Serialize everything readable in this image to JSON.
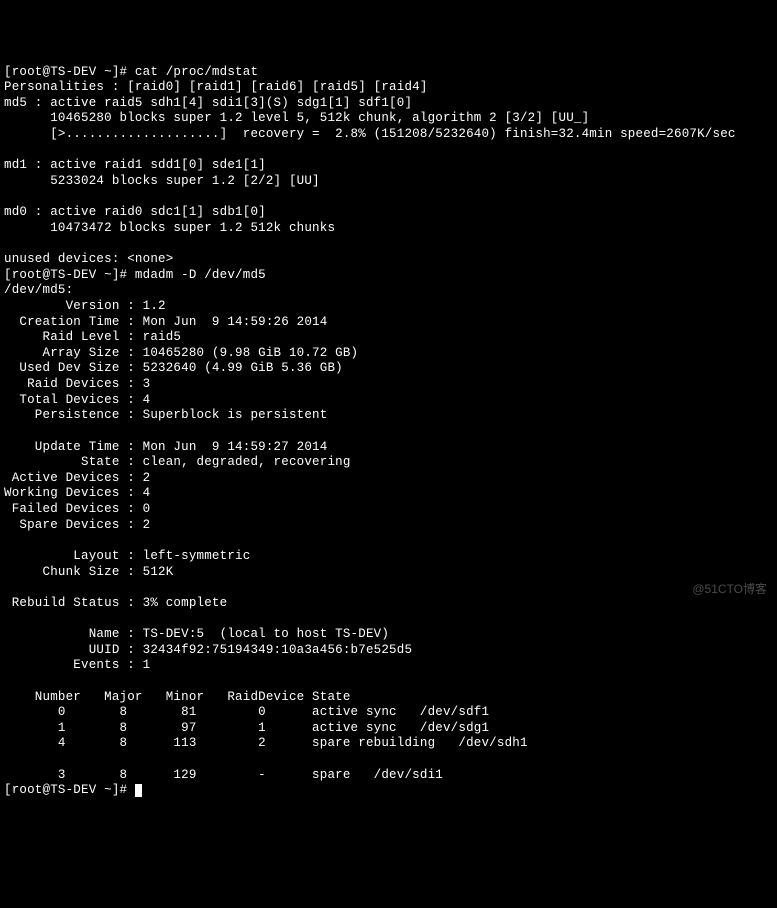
{
  "prompt1": "[root@TS-DEV ~]# ",
  "cmd1": "cat /proc/mdstat",
  "mdstat": {
    "personalities": "Personalities : [raid0] [raid1] [raid6] [raid5] [raid4]",
    "md5_l1": "md5 : active raid5 sdh1[4] sdi1[3](S) sdg1[1] sdf1[0]",
    "md5_l2": "      10465280 blocks super 1.2 level 5, 512k chunk, algorithm 2 [3/2] [UU_]",
    "md5_l3": "      [>....................]  recovery =  2.8% (151208/5232640) finish=32.4min speed=2607K/sec",
    "blank1": "",
    "md1_l1": "md1 : active raid1 sdd1[0] sde1[1]",
    "md1_l2": "      5233024 blocks super 1.2 [2/2] [UU]",
    "blank2": "",
    "md0_l1": "md0 : active raid0 sdc1[1] sdb1[0]",
    "md0_l2": "      10473472 blocks super 1.2 512k chunks",
    "blank3": "",
    "unused": "unused devices: <none>"
  },
  "prompt2": "[root@TS-DEV ~]# ",
  "cmd2": "mdadm -D /dev/md5",
  "mdadm": {
    "header": "/dev/md5:",
    "version": "        Version : 1.2",
    "creation_time": "  Creation Time : Mon Jun  9 14:59:26 2014",
    "raid_level": "     Raid Level : raid5",
    "array_size": "     Array Size : 10465280 (9.98 GiB 10.72 GB)",
    "used_dev_size": "  Used Dev Size : 5232640 (4.99 GiB 5.36 GB)",
    "raid_devices": "   Raid Devices : 3",
    "total_devices": "  Total Devices : 4",
    "persistence": "    Persistence : Superblock is persistent",
    "blank_a": "",
    "update_time": "    Update Time : Mon Jun  9 14:59:27 2014",
    "state": "          State : clean, degraded, recovering",
    "active_dev": " Active Devices : 2",
    "working_dev": "Working Devices : 4",
    "failed_dev": " Failed Devices : 0",
    "spare_dev": "  Spare Devices : 2",
    "blank_b": "",
    "layout": "         Layout : left-symmetric",
    "chunk_size": "     Chunk Size : 512K",
    "blank_c": "",
    "rebuild": " Rebuild Status : 3% complete",
    "blank_d": "",
    "name": "           Name : TS-DEV:5  (local to host TS-DEV)",
    "uuid": "           UUID : 32434f92:75194349:10a3a456:b7e525d5",
    "events": "         Events : 1",
    "blank_e": "",
    "tbl_head": "    Number   Major   Minor   RaidDevice State",
    "tbl_r0": "       0       8       81        0      active sync   /dev/sdf1",
    "tbl_r1": "       1       8       97        1      active sync   /dev/sdg1",
    "tbl_r4": "       4       8      113        2      spare rebuilding   /dev/sdh1",
    "blank_f": "",
    "tbl_r3": "       3       8      129        -      spare   /dev/sdi1"
  },
  "prompt3": "[root@TS-DEV ~]# ",
  "watermark": "@51CTO博客"
}
